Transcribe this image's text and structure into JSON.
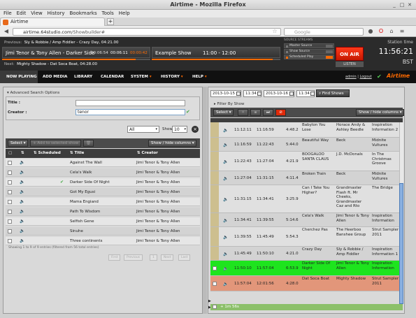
{
  "window": {
    "title": "Airtime - Mozilla Firefox"
  },
  "menu": [
    "File",
    "Edit",
    "View",
    "History",
    "Bookmarks",
    "Tools",
    "Help"
  ],
  "tab": {
    "label": "Airtime",
    "new_tab": "+"
  },
  "nav": {
    "url_host": "airtime.64studio.com",
    "url_path": "/Showbuilder#",
    "search_placeholder": "Google"
  },
  "header": {
    "previous_label": "Previous:",
    "previous_track": "Sly & Robbie / Amp Fiddler - Crazy Day, 04:21.00",
    "current_track": "Jimi Tenor & Tony Allen - Darker Side",
    "current_elapsed": "00:06:54",
    "current_total": "00:06:11",
    "current_remaining": "00:00:42",
    "current_progress": 0.9,
    "next_label": "Next:",
    "next_track": "Mighty Shadow - Dat Soca Boat, 04:28.00",
    "show_name": "Example Show",
    "show_time": "11:00 - 12:00",
    "show_progress": 0.94,
    "source_streams_label": "SOURCE STREAMS",
    "streams": [
      "Master Source",
      "Show Source",
      "Scheduled Play"
    ],
    "on_air": "ON AIR",
    "listen": "LISTEN",
    "station_time_label": "Station time",
    "station_time": "11:56:21",
    "timezone": "BST"
  },
  "mainnav": {
    "items": [
      "NOW PLAYING",
      "ADD MEDIA",
      "LIBRARY",
      "CALENDAR",
      "SYSTEM",
      "HISTORY",
      "HELP"
    ],
    "user": "admin",
    "separator": "|",
    "logout": "Logout",
    "logo": "Airtime"
  },
  "library": {
    "advanced_search": "Advanced Search Options",
    "title_label": "Title :",
    "title_value": "",
    "creator_label": "Creator :",
    "creator_value": "tenor",
    "filter_select": "All",
    "show_label": "Show",
    "show_count": "10",
    "select_label": "Select",
    "add_button": "Add to selected show",
    "show_hide_columns": "Show / hide columns",
    "columns": [
      "Scheduled",
      "Title",
      "Creator"
    ],
    "rows": [
      {
        "title": "Against The Wall",
        "creator": "Jimi Tenor & Tony Allen",
        "scheduled": false
      },
      {
        "title": "Cela's Walk",
        "creator": "Jimi Tenor & Tony Allen",
        "scheduled": false
      },
      {
        "title": "Darker Side Of Night",
        "creator": "Jimi Tenor & Tony Allen",
        "scheduled": true
      },
      {
        "title": "Got My Egusi",
        "creator": "Jimi Tenor & Tony Allen",
        "scheduled": false
      },
      {
        "title": "Mama Engiand",
        "creator": "Jimi Tenor & Tony Allen",
        "scheduled": false
      },
      {
        "title": "Path To Wisdom",
        "creator": "Jimi Tenor & Tony Allen",
        "scheduled": false
      },
      {
        "title": "Selfish Gene",
        "creator": "Jimi Tenor & Tony Allen",
        "scheduled": false
      },
      {
        "title": "Sinuhe",
        "creator": "Jimi Tenor & Tony Allen",
        "scheduled": false
      },
      {
        "title": "Three continents",
        "creator": "Jimi Tenor & Tony Allen",
        "scheduled": false
      }
    ],
    "info": "Showing 1 to 9 of 9 entries (filtered from 56 total entries)",
    "pager": [
      "First",
      "Previous",
      "1",
      "Next",
      "Last"
    ]
  },
  "schedule": {
    "date_start": "2013-10-15",
    "time_start": "11:34",
    "date_end": "2013-10-16",
    "time_end": "11:34",
    "find_shows": "Find Shows",
    "filter_by_show": "Filter By Show",
    "select_label": "Select",
    "show_hide_columns": "Show / hide columns",
    "rows": [
      {
        "start": "11:12:11",
        "end": "11:16:59",
        "length": "4:48.2",
        "title": "Babylon You Lose",
        "creator": "Horace Andy & Ashley Beedle",
        "album": "Inspiration Information 2",
        "state": "normal"
      },
      {
        "start": "11:16:59",
        "end": "11:22:43",
        "length": "5:44.0",
        "title": "Beautiful Way",
        "creator": "Beck",
        "album": "Midnite Vultures",
        "state": "normal"
      },
      {
        "start": "11:22:43",
        "end": "11:27:04",
        "length": "4:21.9",
        "title": "BOOGALOO SANTA CLAUS",
        "creator": "J.D. McDonals",
        "album": "In The Christmas Groove",
        "state": "normal"
      },
      {
        "start": "11:27:04",
        "end": "11:31:15",
        "length": "4:11.4",
        "title": "Broken Train",
        "creator": "Beck",
        "album": "Midnite Vultures",
        "state": "normal"
      },
      {
        "start": "11:31:15",
        "end": "11:34:41",
        "length": "3:25.9",
        "title": "Can I Take You Higher?",
        "creator": "Grandmaster Flash ft. Mr Cheeks, Grandmaster Caz and Rto",
        "album": "The Bridge",
        "state": "normal"
      },
      {
        "start": "11:34:41",
        "end": "11:39:55",
        "length": "5:14.6",
        "title": "Cela's Walk",
        "creator": "Jimi Tenor & Tony Allen",
        "album": "Inspiration Information",
        "state": "normal"
      },
      {
        "start": "11:39:55",
        "end": "11:45:49",
        "length": "5:54.3",
        "title": "Cherchez Pas",
        "creator": "The Heerboo Banshee Group",
        "album": "Strut Sampler 2011",
        "state": "normal"
      },
      {
        "start": "11:45:49",
        "end": "11:50:10",
        "length": "4:21.0",
        "title": "Crazy Day",
        "creator": "Sly & Robbie / Amp Fiddler",
        "album": "Inspiration Information 1",
        "state": "normal"
      },
      {
        "start": "11:50:10",
        "end": "11:57:04",
        "length": "6:53.9",
        "title": "Darker Side Of Night",
        "creator": "Jimi Tenor & Tony Allen",
        "album": "Inspiration Information",
        "state": "playing"
      },
      {
        "start": "11:57:04",
        "end": "12:01:56",
        "length": "4:28.0",
        "title": "Dat Soca Boat",
        "creator": "Mighty Shadow",
        "album": "Strut Sampler 2011",
        "state": "overbooked"
      }
    ],
    "footer": "+ 1m 56s"
  },
  "colors": {
    "accent": "#ff6a00",
    "on_air": "#e02a0a",
    "playing": "#1ee41e",
    "overbooked": "#e2967a"
  }
}
